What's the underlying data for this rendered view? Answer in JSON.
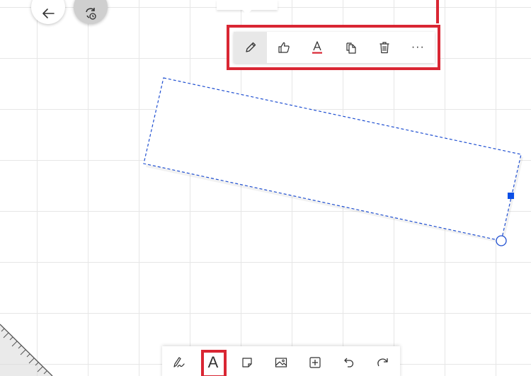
{
  "top_buttons": {
    "back_icon": "arrow-left-icon",
    "sync_icon": "sync-icon"
  },
  "context_toolbar": {
    "items": [
      {
        "name": "edit-pen",
        "icon": "pencil-icon",
        "active": true
      },
      {
        "name": "reaction",
        "icon": "thumbs-up-icon"
      },
      {
        "name": "text-color",
        "icon": "text-color-icon"
      },
      {
        "name": "copy",
        "icon": "copy-icon"
      },
      {
        "name": "delete",
        "icon": "trash-icon"
      },
      {
        "name": "more",
        "icon": "more-icon",
        "label": "···"
      }
    ],
    "highlight_color": "#d92633"
  },
  "selection": {
    "border_color": "#1f4fd1",
    "handle_color": "#0b4fe6"
  },
  "bottom_toolbar": {
    "items": [
      {
        "name": "pen-tool",
        "icon": "pen-icon"
      },
      {
        "name": "text-tool",
        "icon": "text-icon",
        "label": "A",
        "selected": true
      },
      {
        "name": "sticky-note-tool",
        "icon": "sticky-note-icon"
      },
      {
        "name": "image-tool",
        "icon": "image-icon"
      },
      {
        "name": "add-tool",
        "icon": "add-square-icon"
      },
      {
        "name": "undo",
        "icon": "undo-icon"
      },
      {
        "name": "redo",
        "icon": "redo-icon"
      }
    ]
  },
  "ruler": {
    "icon": "ruler-icon"
  }
}
